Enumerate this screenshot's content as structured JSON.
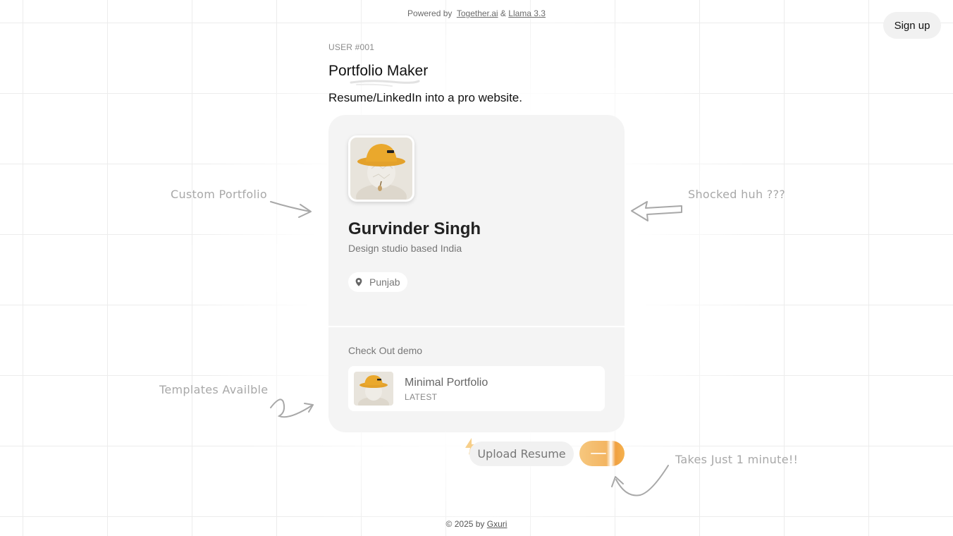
{
  "header": {
    "powered_prefix": "Powered by",
    "together_link": "Together.ai",
    "amp": "&",
    "llama_link": "Llama 3.3",
    "signup_label": "Sign up"
  },
  "hero": {
    "user_id": "USER #001",
    "title": "Portfolio Maker",
    "subtitle": "Resume/LinkedIn into a pro website."
  },
  "profile_card": {
    "name": "Gurvinder Singh",
    "tagline": "Design studio based India",
    "location": "Punjab",
    "check_out_label": "Check Out demo",
    "demo": {
      "title": "Minimal Portfolio",
      "badge": "LATEST"
    }
  },
  "annotations": {
    "left_top": "Custom Portfolio",
    "right_top": "Shocked huh ???",
    "left_bottom": "Templates Availble",
    "right_bottom": "Takes Just 1 minute!!"
  },
  "actions": {
    "upload_label": "Upload Resume"
  },
  "footer": {
    "copyright": "© 2025 by",
    "author_link": "Gxuri"
  },
  "colors": {
    "card_bg": "#f4f4f4",
    "accent_orange": "#f3b562",
    "annotation_gray": "#a8a8a8"
  }
}
